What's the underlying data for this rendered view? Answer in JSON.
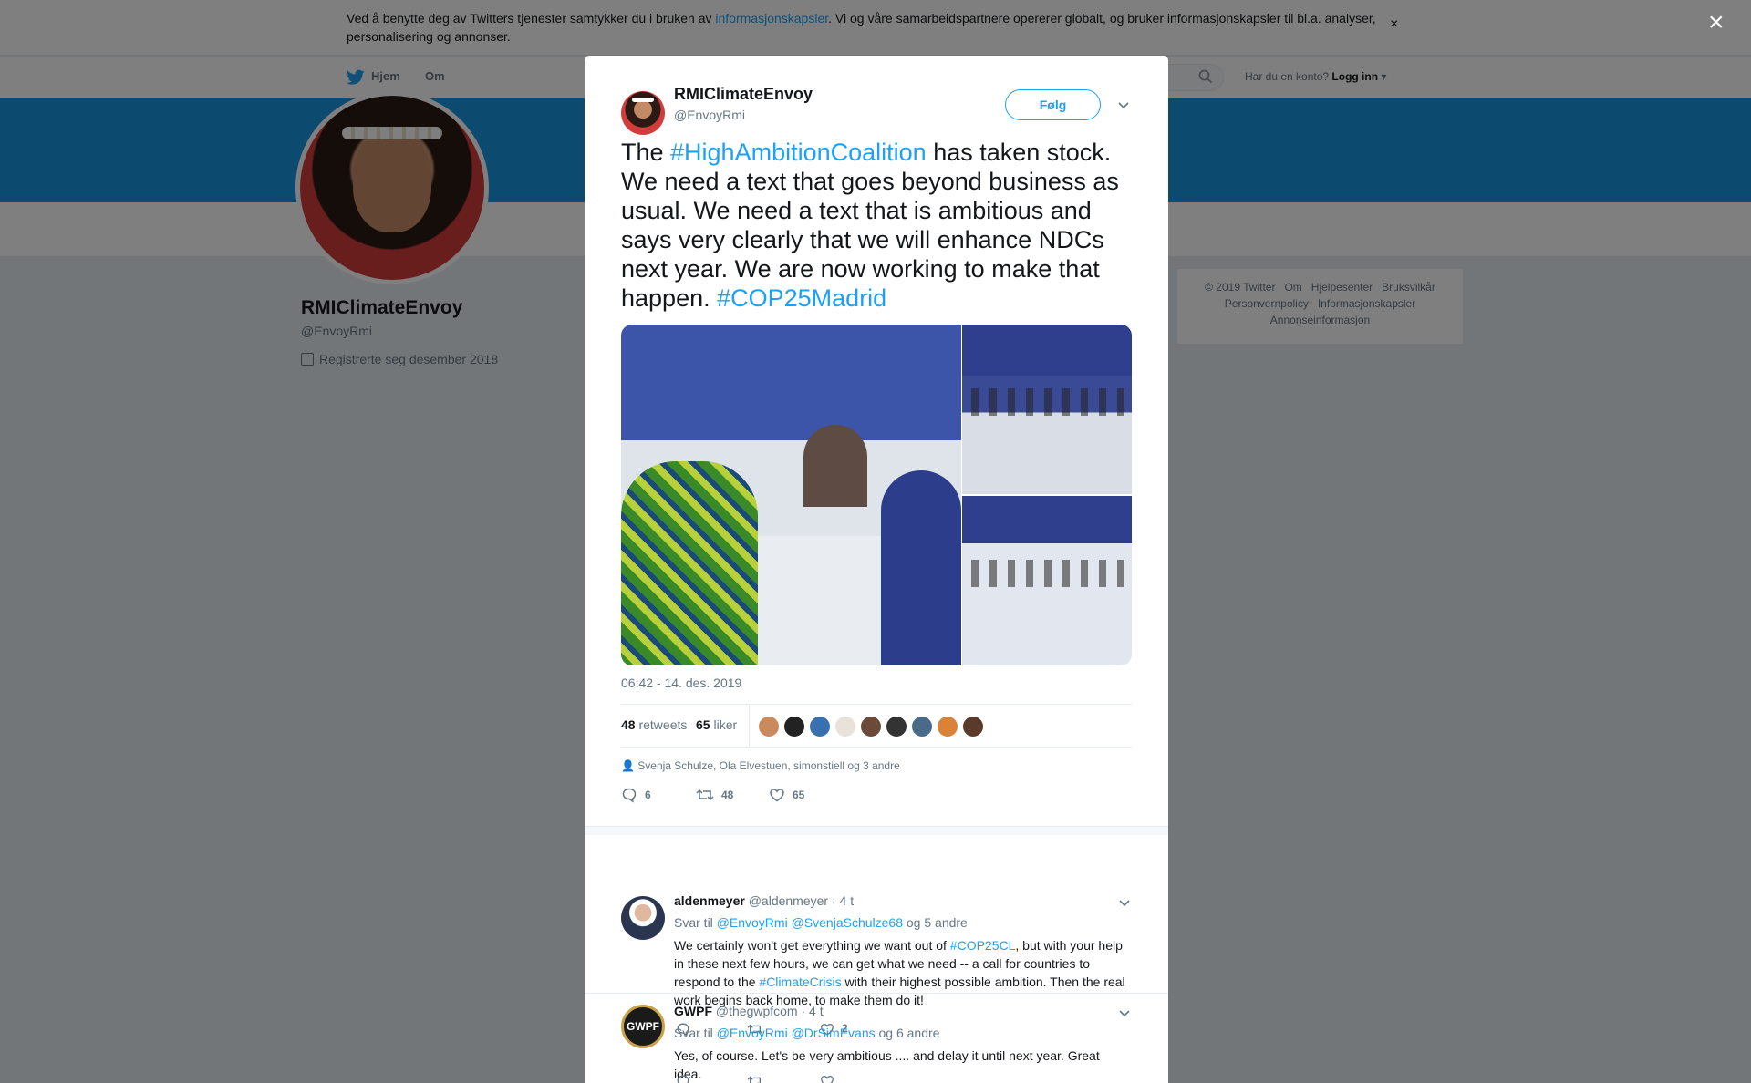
{
  "cookie": {
    "text_before": "Ved å benytte deg av Twitters tjenester samtykker du i bruken av ",
    "link": "informasjonskapsler",
    "text_after": ". Vi og våre samarbeidspartnere opererer globalt, og bruker informasjonskapsler til bl.a. analyser, personalisering og annonser.",
    "close": "×"
  },
  "nav": {
    "home": "Hjem",
    "about": "Om",
    "login_prompt": "Har du en konto?",
    "login": "Logg inn"
  },
  "profile": {
    "name": "RMIClimateEnvoy",
    "handle": "@EnvoyRmi",
    "joined": "Registrerte seg desember 2018"
  },
  "footer": {
    "line1": [
      "© 2019 Twitter",
      "Om",
      "Hjelpesenter",
      "Bruksvilkår"
    ],
    "line2": [
      "Personvernpolicy",
      "Informasjonskapsler"
    ],
    "line3": [
      "Annonseinformasjon"
    ]
  },
  "overlay_close": "×",
  "tweet": {
    "name": "RMIClimateEnvoy",
    "handle": "@EnvoyRmi",
    "follow": "Følg",
    "text_1": "The ",
    "hashtag_1": "#HighAmbitionCoalition",
    "text_2": " has taken stock. We need a text that goes beyond business as usual. We need a text that is ambitious and says very clearly that we will enhance NDCs next year. We are now working to make that happen. ",
    "hashtag_2": "#COP25Madrid",
    "time": "06:42 - 14. des. 2019",
    "retweets_count": "48",
    "retweets_label": "retweets",
    "likes_count": "65",
    "likes_label": "liker",
    "liker_colors": [
      "#c98a5e",
      "#222222",
      "#3a6fb0",
      "#e8e2d8",
      "#6b4a3a",
      "#333333",
      "#4a6a8a",
      "#d8823a",
      "#5a3a2a"
    ],
    "social_context": "Svenja Schulze, Ola Elvestuen, simonstiell og 3 andre",
    "reply_count": "6",
    "retweet_count": "48",
    "like_count": "65"
  },
  "replies": [
    {
      "name": "aldenmeyer",
      "handle": "@aldenmeyer",
      "age": "· 4 t",
      "to_label": "Svar til",
      "to_1": "@EnvoyRmi",
      "to_2": "@SvenjaSchulze68",
      "to_more": "og 5 andre",
      "text_1": "We certainly won't get everything we want out of ",
      "hashtag_1": "#COP25CL",
      "text_2": ", but with your help in these next few hours, we can get what we need -- a call for countries to respond to the ",
      "hashtag_2": "#ClimateCrisis",
      "text_3": " with their highest possible ambition. Then the real work begins back home, to make them do it!",
      "like_count": "2"
    },
    {
      "name": "GWPF",
      "handle": "@thegwpfcom",
      "age": "· 4 t",
      "to_label": "Svar til",
      "to_1": "@EnvoyRmi",
      "to_2": "@DrSimEvans",
      "to_more": "og 6 andre",
      "avatar_text": "GWPF",
      "text_1": "Yes, of course. Let's be very ambitious .... and delay it until next year. Great idea."
    }
  ]
}
